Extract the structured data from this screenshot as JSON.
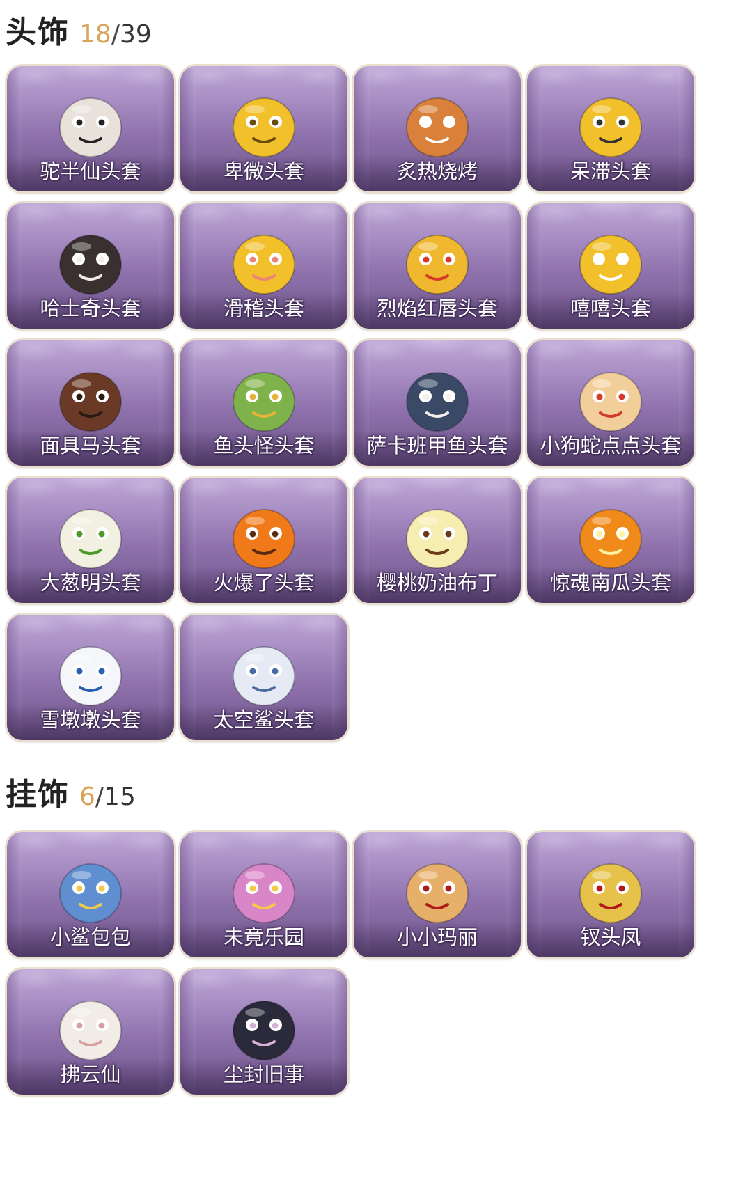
{
  "sections": [
    {
      "title": "头饰",
      "owned": "18",
      "separator": "/",
      "total": "39",
      "items": [
        {
          "label": "驼半仙头套",
          "icon": "alpaca-sunglasses-mask",
          "color": "#e8e2da",
          "accent": "#222222"
        },
        {
          "label": "卑微头套",
          "icon": "humble-emoji-mask",
          "color": "#f2c02a",
          "accent": "#6a4a10"
        },
        {
          "label": "炙热烧烤",
          "icon": "bbq-toast-mask",
          "color": "#d9813a",
          "accent": "#ffffff"
        },
        {
          "label": "呆滞头套",
          "icon": "dazed-emoji-mask",
          "color": "#f2c02a",
          "accent": "#333333"
        },
        {
          "label": "哈士奇头套",
          "icon": "husky-sunglasses-mask",
          "color": "#3a3030",
          "accent": "#f0ece6"
        },
        {
          "label": "滑稽头套",
          "icon": "funny-emoji-mask",
          "color": "#f2c02a",
          "accent": "#e9857a"
        },
        {
          "label": "烈焰红唇头套",
          "icon": "pikachu-style-mask",
          "color": "#f0b82e",
          "accent": "#d63a2a"
        },
        {
          "label": "嘻嘻头套",
          "icon": "grin-emoji-mask",
          "color": "#f2c02a",
          "accent": "#ffffff"
        },
        {
          "label": "面具马头套",
          "icon": "horse-mask",
          "color": "#6a3a26",
          "accent": "#2a1a12"
        },
        {
          "label": "鱼头怪头套",
          "icon": "fish-head-mask",
          "color": "#7fb24a",
          "accent": "#e6b23a"
        },
        {
          "label": "萨卡班甲鱼头套",
          "icon": "sacabambaspis-mask",
          "color": "#3a4a66",
          "accent": "#f4f0ea"
        },
        {
          "label": "小狗蛇点点头套",
          "icon": "dog-snake-mask",
          "color": "#f2cf9a",
          "accent": "#d23a2a"
        },
        {
          "label": "大葱明头套",
          "icon": "green-onion-mask",
          "color": "#f2f0e0",
          "accent": "#4c9a2a"
        },
        {
          "label": "火爆了头套",
          "icon": "fire-spirit-mask",
          "color": "#f07a1a",
          "accent": "#5a2a10"
        },
        {
          "label": "樱桃奶油布丁",
          "icon": "cherry-pudding-mask",
          "color": "#f6eeb0",
          "accent": "#6a3a1a"
        },
        {
          "label": "惊魂南瓜头套",
          "icon": "pumpkin-mask",
          "color": "#f08a1a",
          "accent": "#fff2a0"
        },
        {
          "label": "雪墩墩头套",
          "icon": "snowman-reindeer-mask",
          "color": "#f4f6fa",
          "accent": "#2a5fb0"
        },
        {
          "label": "太空鲨头套",
          "icon": "space-shark-mask",
          "color": "#e6eaf4",
          "accent": "#4a6aa0"
        }
      ]
    },
    {
      "title": "挂饰",
      "owned": "6",
      "separator": "/",
      "total": "15",
      "items": [
        {
          "label": "小鲨包包",
          "icon": "shark-bag-charm",
          "color": "#5f8fd0",
          "accent": "#f4c84a"
        },
        {
          "label": "未竟乐园",
          "icon": "pink-hair-doll-charm",
          "color": "#d986c8",
          "accent": "#f4c84a"
        },
        {
          "label": "小小玛丽",
          "icon": "blonde-doll-charm",
          "color": "#e6b06a",
          "accent": "#b01a1a"
        },
        {
          "label": "钗头凤",
          "icon": "phoenix-crown-doll-charm",
          "color": "#e6c24a",
          "accent": "#b01a1a"
        },
        {
          "label": "拂云仙",
          "icon": "white-fairy-charm",
          "color": "#f2ece6",
          "accent": "#d6a0a0"
        },
        {
          "label": "尘封旧事",
          "icon": "dark-hair-doll-charm",
          "color": "#2a2a3a",
          "accent": "#d6b0d6"
        }
      ]
    }
  ]
}
